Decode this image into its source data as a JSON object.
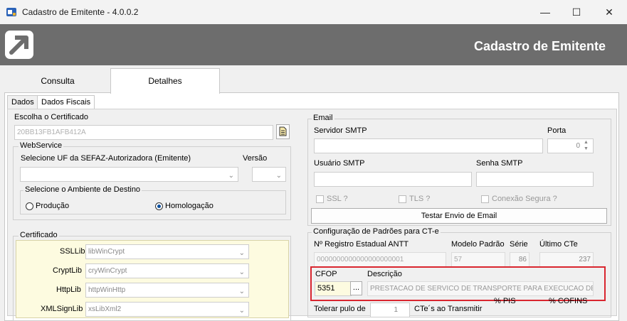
{
  "window": {
    "title": "Cadastro de Emitente - 4.0.0.2",
    "minimize_icon": "minimize-icon",
    "maximize_icon": "maximize-icon",
    "close_icon": "close-icon"
  },
  "header": {
    "title": "Cadastro de Emitente"
  },
  "main_tabs": [
    "Consulta",
    "Detalhes"
  ],
  "sub_tabs": [
    "Dados",
    "Dados Fiscais"
  ],
  "certificado": {
    "label": "Escolha o Certificado",
    "value": "20BB13FB1AFB412A"
  },
  "webservice": {
    "caption": "WebService",
    "uf_label": "Selecione UF da SEFAZ-Autorizadora (Emitente)",
    "uf_value": "",
    "versao_label": "Versão",
    "versao_value": "",
    "ambiente_caption": "Selecione o Ambiente de Destino",
    "producao": "Produção",
    "homologacao": "Homologação",
    "selected": "homologacao"
  },
  "cert_group": {
    "caption": "Certificado",
    "ssl_label": "SSLLib",
    "ssl_value": "libWinCrypt",
    "crypt_label": "CryptLib",
    "crypt_value": "cryWinCrypt",
    "http_label": "HttpLib",
    "http_value": "httpWinHttp",
    "xml_label": "XMLSignLib",
    "xml_value": "xsLibXml2"
  },
  "email": {
    "caption": "Email",
    "servidor_label": "Servidor SMTP",
    "servidor_value": "",
    "porta_label": "Porta",
    "porta_value": "0",
    "usuario_label": "Usuário SMTP",
    "usuario_value": "",
    "senha_label": "Senha SMTP",
    "senha_value": "",
    "ssl": "SSL ?",
    "tls": "TLS ?",
    "conexao": "Conexão Segura ?",
    "test_button": "Testar Envio de Email"
  },
  "cte": {
    "caption": "Configuração de Padrões para CT-e",
    "antt_label": "Nº Registro Estadual ANTT",
    "antt_value": "0000000000000000000001",
    "modelo_label": "Modelo Padrão",
    "modelo_value": "57",
    "serie_label": "Série",
    "serie_value": "86",
    "ultimo_label": "Último CTe",
    "ultimo_value": "237",
    "cfop_label": "CFOP",
    "cfop_value": "5351",
    "cfop_button": "...",
    "descricao_label": "Descrição",
    "descricao_value": "PRESTACAO DE SERVICO DE TRANSPORTE PARA EXECUCAO DE",
    "tolerar_label": "Tolerar pulo de",
    "tolerar_value": "1",
    "ctes_label": "CTe´s ao Transmitir",
    "pis_label": "% PIS",
    "cofins_label": "% COFINS"
  },
  "colors": {
    "header_bg": "#6d6d6d",
    "highlight_border": "#d9262f",
    "cert_bg": "#fdfbe0"
  }
}
